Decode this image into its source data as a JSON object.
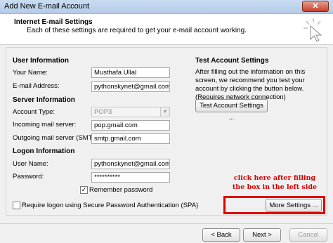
{
  "window": {
    "title": "Add New E-mail Account",
    "close_glyph": "✕"
  },
  "header": {
    "title": "Internet E-mail Settings",
    "subtitle": "Each of these settings are required to get your e-mail account working."
  },
  "user_info": {
    "heading": "User Information",
    "name_label": "Your Name:",
    "name_value": "Musthafa Ullal",
    "email_label": "E-mail Address:",
    "email_value": "pythonskynet@gmail.com"
  },
  "server_info": {
    "heading": "Server Information",
    "account_type_label": "Account Type:",
    "account_type_value": "POP3",
    "incoming_label": "Incoming mail server:",
    "incoming_value": "pop.gmail.com",
    "outgoing_label": "Outgoing mail server (SMTP):",
    "outgoing_value": "smtp.gmail.com"
  },
  "logon_info": {
    "heading": "Logon Information",
    "username_label": "User Name:",
    "username_value": "pythonskynet@gmail.com",
    "password_label": "Password:",
    "password_value": "**********",
    "remember_label": "Remember password",
    "remember_checked": true,
    "spa_label": "Require logon using Secure Password Authentication (SPA)",
    "spa_checked": false
  },
  "test_settings": {
    "heading": "Test Account Settings",
    "description": "After filling out the information on this screen, we recommend you test your account by clicking the button below. (Requires network connection)",
    "button_label": "Test Account Settings ..."
  },
  "annotation": {
    "line1": "click here after filling",
    "line2": "the box in the left side",
    "color": "#d40000"
  },
  "more_settings_label": "More Settings ...",
  "nav": {
    "back_label": "< Back",
    "next_label": "Next >",
    "cancel_label": "Cancel"
  },
  "checkmark_glyph": "✓"
}
